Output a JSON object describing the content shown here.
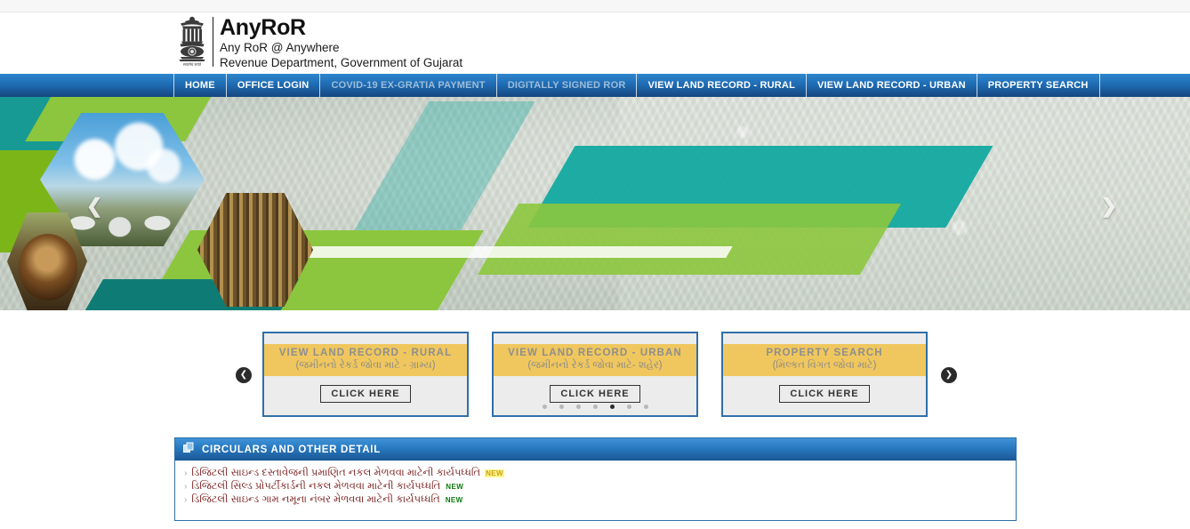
{
  "site": {
    "title": "AnyRoR",
    "tagline": "Any RoR @ Anywhere",
    "department": "Revenue Department, Government of Gujarat",
    "emblem_icon": "india-state-emblem-icon"
  },
  "nav": {
    "items": [
      {
        "label": "HOME",
        "dim": false
      },
      {
        "label": "OFFICE LOGIN",
        "dim": false
      },
      {
        "label": "COVID-19 EX-GRATIA PAYMENT",
        "dim": true
      },
      {
        "label": "DIGITALLY SIGNED ROR",
        "dim": true
      },
      {
        "label": "VIEW LAND RECORD - RURAL",
        "dim": false
      },
      {
        "label": "VIEW LAND RECORD - URBAN",
        "dim": false
      },
      {
        "label": "PROPERTY SEARCH",
        "dim": false
      }
    ]
  },
  "banner": {
    "prev_icon": "chevron-left-icon",
    "next_icon": "chevron-right-icon",
    "indicator_count": 1,
    "active_indicator": 0
  },
  "cards": {
    "prev_icon": "circle-chevron-left-icon",
    "next_icon": "circle-chevron-right-icon",
    "items": [
      {
        "title_en": "VIEW LAND RECORD - RURAL",
        "title_gu": "(જમીનનો રેકર્ડ જોવા માટે - ગ્રામ્ય)",
        "button": "CLICK HERE"
      },
      {
        "title_en": "VIEW LAND RECORD - URBAN",
        "title_gu": "(જમીનનો રેકર્ડ જોવા માટે- શહેર)",
        "button": "CLICK HERE"
      },
      {
        "title_en": "PROPERTY SEARCH",
        "title_gu": "(મિલ્કત વિગત જોવા માટે)",
        "button": "CLICK HERE"
      }
    ],
    "dots": 7,
    "active_dot": 4
  },
  "circulars": {
    "header": "CIRCULARS AND OTHER DETAIL",
    "header_icon": "copy-documents-icon",
    "items": [
      {
        "text": "ડિજિટલી સાઇન્ડ દસ્તાવેજની પ્રમાણિત નકલ મેળવવા માટેની કાર્યપધ્ધતિ",
        "badge": "NEW",
        "badge_color": "yellow"
      },
      {
        "text": "ડિજિટલી સિલ્ડ પ્રોપર્ટીકાર્ડની નકલ મેળવવા માટેની કાર્યપધ્ધતિ",
        "badge": "NEW",
        "badge_color": "green"
      },
      {
        "text": "ડિજિટલી સાઇન્ડ ગામ નમૂના નંબર મેળવવા માટેની કાર્યપધ્ધતિ",
        "badge": "NEW",
        "badge_color": "green"
      }
    ]
  },
  "colors": {
    "nav_blue": "#1f6cb4",
    "card_band": "#f0c75e",
    "card_border": "#2f6fa8",
    "link_maroon": "#7a1f1f"
  }
}
